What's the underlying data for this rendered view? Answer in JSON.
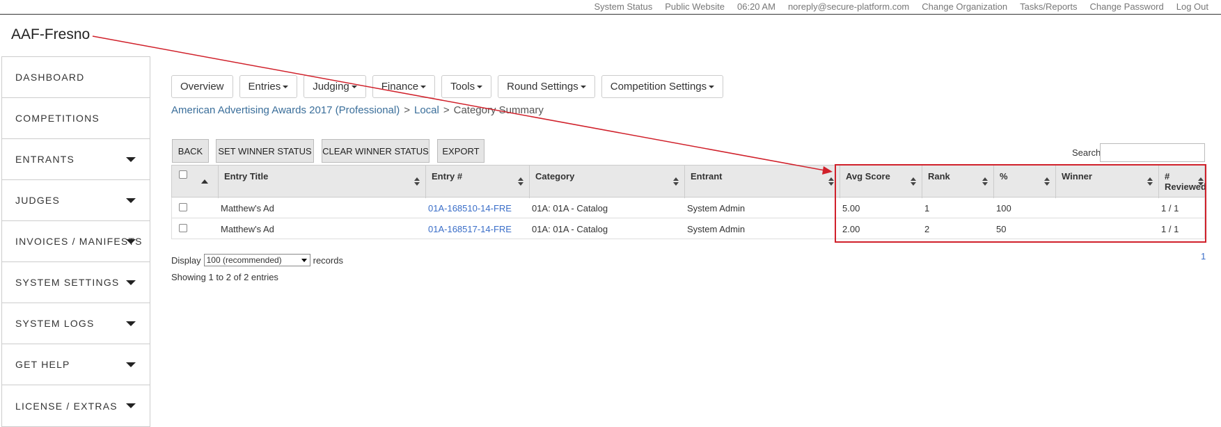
{
  "topbar": {
    "links": [
      "System Status",
      "Public Website",
      "06:20 AM",
      "noreply@secure-platform.com",
      "Change Organization",
      "Tasks/Reports",
      "Change Password",
      "Log Out"
    ]
  },
  "org": {
    "title": "AAF-Fresno"
  },
  "sidebar": {
    "items": [
      {
        "label": "DASHBOARD",
        "dropdown": false
      },
      {
        "label": "COMPETITIONS",
        "dropdown": false
      },
      {
        "label": "ENTRANTS",
        "dropdown": true
      },
      {
        "label": "JUDGES",
        "dropdown": true
      },
      {
        "label": "INVOICES / MANIFESTS",
        "dropdown": true
      },
      {
        "label": "SYSTEM SETTINGS",
        "dropdown": true
      },
      {
        "label": "SYSTEM LOGS",
        "dropdown": true
      },
      {
        "label": "GET HELP",
        "dropdown": true
      },
      {
        "label": "LICENSE / EXTRAS",
        "dropdown": true
      }
    ]
  },
  "nav": {
    "overview": "Overview",
    "entries": "Entries",
    "judging": "Judging",
    "finance": "Finance",
    "tools": "Tools",
    "round_settings": "Round Settings",
    "competition_settings": "Competition Settings"
  },
  "breadcrumb": {
    "competition": "American Advertising Awards 2017 (Professional)",
    "sep": ">",
    "round": "Local",
    "current": "Category Summary"
  },
  "actions": {
    "back": "BACK",
    "set_winner": "SET WINNER STATUS",
    "clear_winner": "CLEAR WINNER STATUS",
    "export": "EXPORT"
  },
  "search": {
    "label": "Search:",
    "value": ""
  },
  "table": {
    "headers": {
      "entry_title": "Entry Title",
      "entry_no": "Entry #",
      "category": "Category",
      "entrant": "Entrant",
      "avg_score": "Avg Score",
      "rank": "Rank",
      "pct": "%",
      "winner": "Winner",
      "reviewed_1": "#",
      "reviewed_2": "Reviewed"
    },
    "rows": [
      {
        "title": "Matthew's Ad",
        "entry_no": "01A-168510-14-FRE",
        "category": "01A: 01A - Catalog",
        "entrant": "System Admin",
        "avg_score": "5.00",
        "rank": "1",
        "pct": "100",
        "winner": "",
        "reviewed": "1 / 1"
      },
      {
        "title": "Matthew's Ad",
        "entry_no": "01A-168517-14-FRE",
        "category": "01A: 01A - Catalog",
        "entrant": "System Admin",
        "avg_score": "2.00",
        "rank": "2",
        "pct": "50",
        "winner": "",
        "reviewed": "1 / 1"
      }
    ]
  },
  "footer": {
    "display_label": "Display",
    "display_value": "100 (recommended)",
    "records_label": "records",
    "showing": "Showing 1 to 2 of 2 entries",
    "page": "1"
  },
  "colors": {
    "annotation": "#d0202a",
    "link": "#3a6ec8"
  }
}
